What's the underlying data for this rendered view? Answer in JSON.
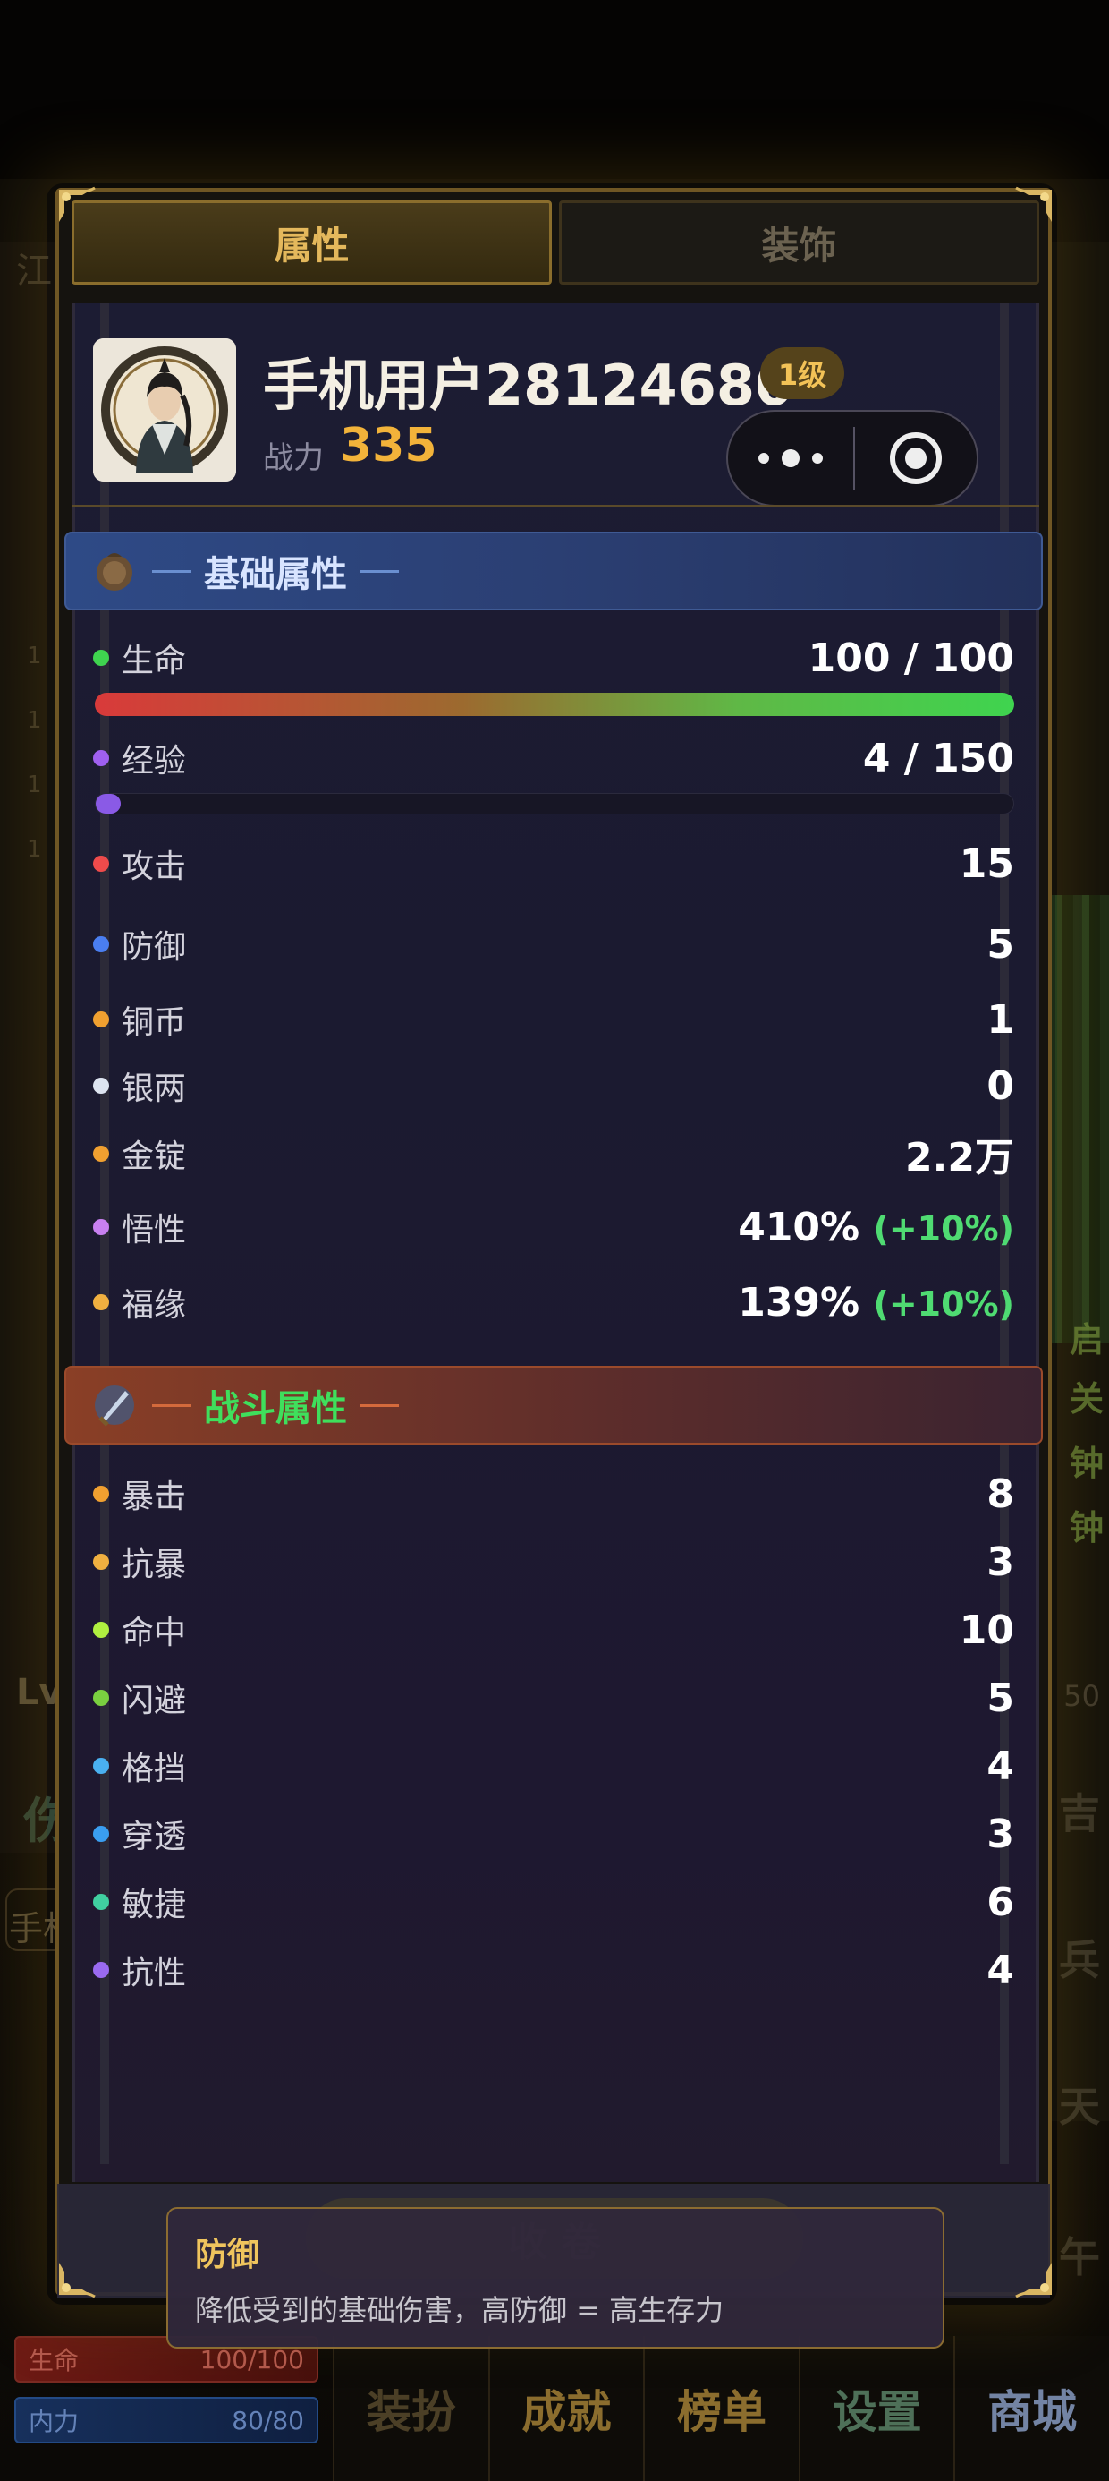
{
  "tabs": [
    {
      "label": "属性",
      "active": true
    },
    {
      "label": "装饰",
      "active": false
    }
  ],
  "profile": {
    "username": "手机用户28124680",
    "level_badge": "1级",
    "power_label": "战力",
    "power_value": "335"
  },
  "basic_section": {
    "title": "基础属性",
    "icon": "coin-pouch-icon",
    "hp": {
      "label": "生命",
      "value": "100 / 100",
      "fraction": 1.0,
      "color": "#3fd44f"
    },
    "xp": {
      "label": "经验",
      "value": "4 / 150",
      "fraction": 0.027,
      "color": "#a060f0"
    },
    "stats": [
      {
        "label": "攻击",
        "value": "15",
        "bullet": "#ee4b4b"
      },
      {
        "label": "防御",
        "value": "5",
        "bullet": "#4a7ef0"
      },
      {
        "label": "铜币",
        "value": "1",
        "bullet": "#f0a030"
      },
      {
        "label": "银两",
        "value": "0",
        "bullet": "#dde4f0"
      },
      {
        "label": "金锭",
        "value": "2.2万",
        "bullet": "#f0a030"
      },
      {
        "label": "悟性",
        "value": "410%",
        "bonus": "(+10%)",
        "bullet": "#c880f0"
      },
      {
        "label": "福缘",
        "value": "139%",
        "bonus": "(+10%)",
        "bullet": "#f0b040"
      }
    ]
  },
  "battle_section": {
    "title": "战斗属性",
    "icon": "sword-shield-icon",
    "stats": [
      {
        "label": "暴击",
        "value": "8",
        "bullet": "#f0a030"
      },
      {
        "label": "抗暴",
        "value": "3",
        "bullet": "#f0b040"
      },
      {
        "label": "命中",
        "value": "10",
        "bullet": "#b0f040"
      },
      {
        "label": "闪避",
        "value": "5",
        "bullet": "#7ad040"
      },
      {
        "label": "格挡",
        "value": "4",
        "bullet": "#4ab0f0"
      },
      {
        "label": "穿透",
        "value": "3",
        "bullet": "#3a9ef0"
      },
      {
        "label": "敏捷",
        "value": "6",
        "bullet": "#40d0a0"
      },
      {
        "label": "抗性",
        "value": "4",
        "bullet": "#9a6af0"
      }
    ]
  },
  "collapse_button": "收 卷",
  "tooltip": {
    "title": "防御",
    "description": "降低受到的基础伤害，高防御 = 高生存力"
  },
  "bottom_bars": {
    "hp_label": "生命",
    "hp_value": "100/100",
    "mp_label": "内力",
    "mp_value": "80/80"
  },
  "bottom_nav": [
    "装扮",
    "成就",
    "榜单",
    "设置",
    "商城"
  ],
  "background": {
    "lv_text": "Lv",
    "right_num": "50",
    "hand_text": "手机",
    "left_char": "伤",
    "right_chars": [
      "启",
      "关",
      "钟",
      "钟"
    ],
    "side_chars": [
      "吉",
      "兵",
      "天",
      "午"
    ],
    "left_ticks": [
      "1",
      "1",
      "1",
      "1"
    ],
    "top_left_char": "江"
  }
}
